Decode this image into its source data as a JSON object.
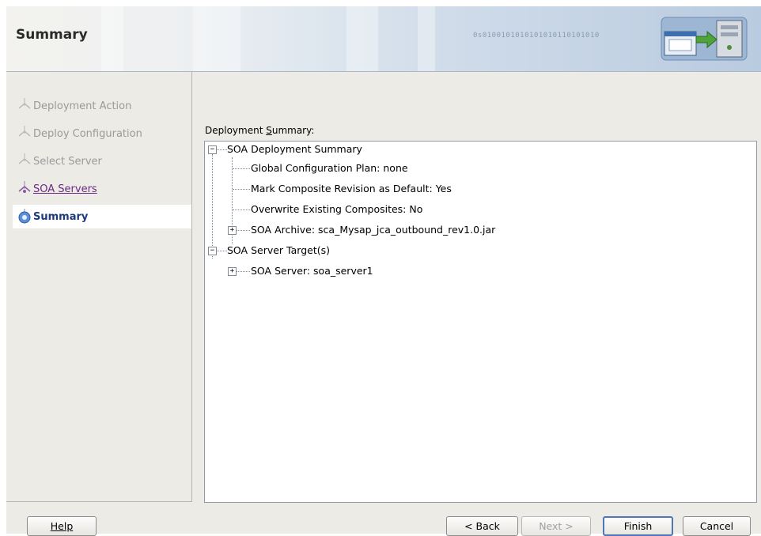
{
  "header": {
    "title": "Summary",
    "binary_text": "0s0100101010101010110101010"
  },
  "train": {
    "steps": [
      {
        "label": "Deployment Action",
        "state": "inactive"
      },
      {
        "label": "Deploy Configuration",
        "state": "inactive"
      },
      {
        "label": "Select Server",
        "state": "inactive"
      },
      {
        "label": "SOA Servers",
        "state": "visited"
      },
      {
        "label": "Summary",
        "state": "current"
      }
    ]
  },
  "summary": {
    "label_prefix": "Deployment ",
    "label_mnemonic": "S",
    "label_rest": "ummary:",
    "tree": {
      "root1": "SOA Deployment Summary",
      "child1": "Global Configuration Plan: none",
      "child2": "Mark Composite Revision as Default: Yes",
      "child3": "Overwrite Existing Composites: No",
      "child4": "SOA Archive: sca_Mysap_jca_outbound_rev1.0.jar",
      "root2": "SOA Server Target(s)",
      "child5": "SOA Server: soa_server1"
    }
  },
  "buttons": {
    "help": "Help",
    "back": "< Back",
    "next": "Next >",
    "finish": "Finish",
    "cancel": "Cancel"
  },
  "colors": {
    "visited_link": "#6b2a86",
    "current_step": "#1c3a7a",
    "default_button_border": "#4f77b6"
  }
}
